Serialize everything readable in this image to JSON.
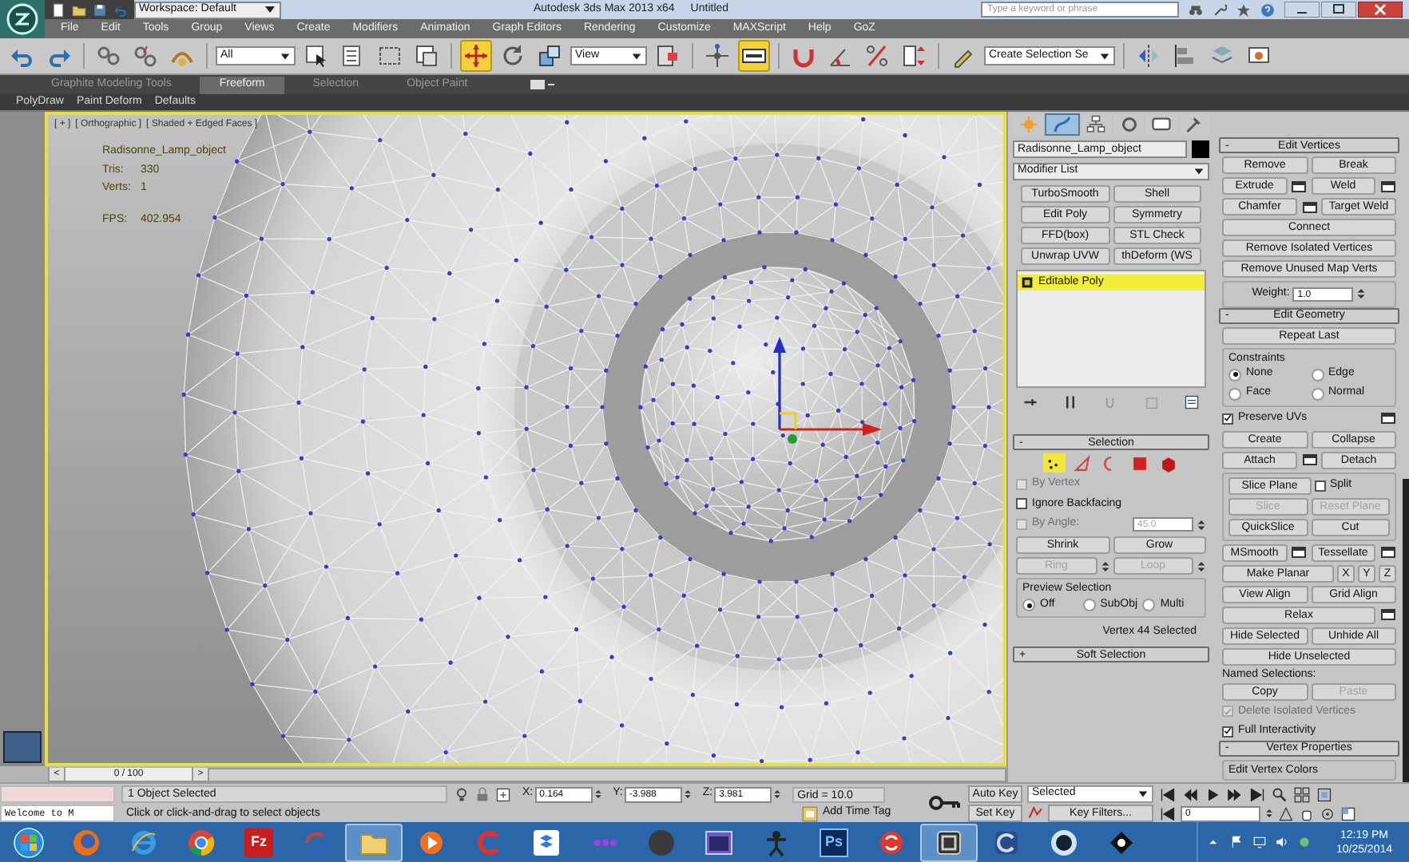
{
  "title_bar": {
    "workspace": "Workspace: Default",
    "app_title": "Autodesk 3ds Max  2013 x64",
    "document": "Untitled",
    "search_placeholder": "Type a keyword or phrase"
  },
  "menu": [
    "File",
    "Edit",
    "Tools",
    "Group",
    "Views",
    "Create",
    "Modifiers",
    "Animation",
    "Graph Editors",
    "Rendering",
    "Customize",
    "MAXScript",
    "Help",
    "GoZ"
  ],
  "toolbar": [
    {
      "kind": "undo",
      "selected": false
    },
    {
      "kind": "redo",
      "selected": false
    },
    {
      "kind": "separator"
    },
    {
      "kind": "link",
      "selected": false
    },
    {
      "kind": "unlink",
      "selected": false
    },
    {
      "kind": "bind",
      "selected": false
    },
    {
      "kind": "separator"
    },
    {
      "kind": "dropdown",
      "value": "All"
    },
    {
      "kind": "select",
      "selected": false
    },
    {
      "kind": "selectname",
      "selected": false
    },
    {
      "kind": "region",
      "selected": false
    },
    {
      "kind": "crossing",
      "selected": false
    },
    {
      "kind": "separator"
    },
    {
      "kind": "move",
      "selected": true
    },
    {
      "kind": "rotate",
      "selected": false
    },
    {
      "kind": "scale",
      "selected": false
    },
    {
      "kind": "dropdown",
      "value": "View"
    },
    {
      "kind": "pivot",
      "selected": false
    },
    {
      "kind": "separator"
    },
    {
      "kind": "manipulate",
      "selected": false
    },
    {
      "kind": "keyboard",
      "selected": true
    },
    {
      "kind": "separator"
    },
    {
      "kind": "snap",
      "selected": false
    },
    {
      "kind": "anglesnap",
      "selected": false
    },
    {
      "kind": "percentsnap",
      "selected": false
    },
    {
      "kind": "spinsnap",
      "selected": false
    },
    {
      "kind": "separator"
    },
    {
      "kind": "editnamed",
      "selected": false
    },
    {
      "kind": "dropdown",
      "value": "Create Selection Se"
    },
    {
      "kind": "separator"
    },
    {
      "kind": "mirror",
      "selected": false
    },
    {
      "kind": "align",
      "selected": false
    },
    {
      "kind": "layers",
      "selected": false
    },
    {
      "kind": "render",
      "selected": false
    }
  ],
  "ribbon": {
    "tabs": [
      {
        "label": "Graphite Modeling Tools",
        "selected": false
      },
      {
        "label": "Freeform",
        "selected": true
      },
      {
        "label": "Selection",
        "selected": false
      },
      {
        "label": "Object Paint",
        "selected": false
      }
    ],
    "panels": [
      "PolyDraw",
      "Paint Deform",
      "Defaults"
    ]
  },
  "viewport": {
    "active": true,
    "labels": [
      "[ + ]",
      "[ Orthographic ]",
      "[ Shaded + Edged Faces ]"
    ],
    "object": "Radisonne_Lamp_object",
    "stats": [
      {
        "label": "Tris:",
        "value": "330"
      },
      {
        "label": "Verts:",
        "value": "1"
      },
      {
        "label": "FPS:",
        "value": "402.954"
      }
    ]
  },
  "command_panel": {
    "tabs": [
      {
        "kind": "create",
        "selected": false
      },
      {
        "kind": "modify",
        "selected": true
      },
      {
        "kind": "hierarchy",
        "selected": false
      },
      {
        "kind": "motion",
        "selected": false
      },
      {
        "kind": "display",
        "selected": false
      },
      {
        "kind": "utilities",
        "selected": false
      }
    ],
    "object_name": "Radisonne_Lamp_object",
    "modifier_list": "Modifier List",
    "modifier_buttons": [
      "TurboSmooth",
      "Shell",
      "Edit Poly",
      "Symmetry",
      "FFD(box)",
      "STL Check",
      "Unwrap UVW",
      "thDeform (WS"
    ],
    "stack": [
      {
        "label": "Editable Poly",
        "selected": true
      }
    ],
    "stack_tools": [
      {
        "kind": "pin",
        "disabled": false
      },
      {
        "kind": "showend",
        "disabled": false
      },
      {
        "kind": "unique",
        "disabled": true
      },
      {
        "kind": "remove",
        "disabled": true
      },
      {
        "kind": "configure",
        "disabled": false
      }
    ],
    "rollouts": [
      {
        "sign": "-",
        "title": "Selection",
        "items": [
          {
            "kind": "levels",
            "items": [
              {
                "kind": "vertex",
                "selected": true
              },
              {
                "kind": "edge",
                "selected": false
              },
              {
                "kind": "border",
                "selected": false
              },
              {
                "kind": "polygon",
                "selected": false
              },
              {
                "kind": "element",
                "selected": false
              }
            ]
          },
          {
            "kind": "checkbox",
            "label": "By Vertex",
            "checked": false,
            "disabled": true
          },
          {
            "kind": "checkbox",
            "label": "Ignore Backfacing",
            "checked": false,
            "disabled": false
          },
          {
            "kind": "row",
            "items": [
              {
                "kind": "checkbox",
                "label": "By Angle:",
                "checked": false,
                "disabled": true
              },
              {
                "kind": "spinner",
                "value": "45.0",
                "disabled": true
              }
            ]
          },
          {
            "kind": "row",
            "items": [
              {
                "kind": "button",
                "label": "Shrink",
                "disabled": false
              },
              {
                "kind": "button",
                "label": "Grow",
                "disabled": false
              }
            ]
          },
          {
            "kind": "row",
            "items": [
              {
                "kind": "button",
                "label": "Ring",
                "disabled": true
              },
              {
                "kind": "spin"
              },
              {
                "kind": "button",
                "label": "Loop",
                "disabled": true
              },
              {
                "kind": "spin"
              }
            ]
          },
          {
            "kind": "group",
            "title": "Preview Selection",
            "items": [
              {
                "kind": "row",
                "items": [
                  {
                    "kind": "radio",
                    "label": "Off",
                    "selected": true
                  },
                  {
                    "kind": "radio",
                    "label": "SubObj",
                    "selected": false
                  },
                  {
                    "kind": "radio",
                    "label": "Multi",
                    "selected": false
                  }
                ]
              }
            ]
          },
          {
            "kind": "status",
            "label": "Vertex 44 Selected"
          }
        ]
      },
      {
        "sign": "+",
        "title": "Soft Selection"
      }
    ]
  },
  "modify_panel": {
    "rollouts": [
      {
        "sign": "-",
        "title": "Edit Vertices",
        "items": [
          {
            "kind": "row",
            "items": [
              {
                "kind": "button",
                "label": "Remove",
                "disabled": false
              },
              {
                "kind": "button",
                "label": "Break",
                "disabled": false
              }
            ]
          },
          {
            "kind": "row",
            "items": [
              {
                "kind": "button",
                "label": "Extrude",
                "disabled": false
              },
              {
                "kind": "settings"
              },
              {
                "kind": "button",
                "label": "Weld",
                "disabled": false
              },
              {
                "kind": "settings"
              }
            ]
          },
          {
            "kind": "row",
            "items": [
              {
                "kind": "button",
                "label": "Chamfer",
                "disabled": false
              },
              {
                "kind": "settings"
              },
              {
                "kind": "button",
                "label": "Target Weld",
                "disabled": false
              }
            ]
          },
          {
            "kind": "row",
            "items": [
              {
                "kind": "button",
                "label": "Connect",
                "disabled": false
              }
            ]
          },
          {
            "kind": "row",
            "items": [
              {
                "kind": "button",
                "label": "Remove Isolated Vertices",
                "disabled": false
              }
            ]
          },
          {
            "kind": "row",
            "items": [
              {
                "kind": "button",
                "label": "Remove Unused Map Verts",
                "disabled": false
              }
            ]
          },
          {
            "kind": "group",
            "items": [
              {
                "kind": "spinner",
                "label": "Weight:",
                "value": "1.0",
                "disabled": false
              }
            ]
          }
        ]
      },
      {
        "sign": "-",
        "title": "Edit Geometry",
        "items": [
          {
            "kind": "row",
            "items": [
              {
                "kind": "button",
                "label": "Repeat Last",
                "disabled": false
              }
            ]
          },
          {
            "kind": "group",
            "title": "Constraints",
            "items": [
              {
                "kind": "row",
                "items": [
                  {
                    "kind": "radio",
                    "label": "None",
                    "selected": true
                  },
                  {
                    "kind": "radio",
                    "label": "Edge",
                    "selected": false
                  }
                ]
              },
              {
                "kind": "row",
                "items": [
                  {
                    "kind": "radio",
                    "label": "Face",
                    "selected": false
                  },
                  {
                    "kind": "radio",
                    "label": "Normal",
                    "selected": false
                  }
                ]
              }
            ]
          },
          {
            "kind": "row",
            "items": [
              {
                "kind": "checkbox",
                "label": "Preserve UVs",
                "checked": true,
                "disabled": false
              },
              {
                "kind": "settings"
              }
            ]
          },
          {
            "kind": "row",
            "items": [
              {
                "kind": "button",
                "label": "Create",
                "disabled": false
              },
              {
                "kind": "button",
                "label": "Collapse",
                "disabled": false
              }
            ]
          },
          {
            "kind": "row",
            "items": [
              {
                "kind": "button",
                "label": "Attach",
                "disabled": false
              },
              {
                "kind": "settings"
              },
              {
                "kind": "button",
                "label": "Detach",
                "disabled": false
              }
            ]
          },
          {
            "kind": "group",
            "items": [
              {
                "kind": "row",
                "items": [
                  {
                    "kind": "button",
                    "label": "Slice Plane",
                    "disabled": false
                  },
                  {
                    "kind": "checkbox",
                    "label": "Split",
                    "checked": false,
                    "disabled": false
                  }
                ]
              },
              {
                "kind": "row",
                "items": [
                  {
                    "kind": "button",
                    "label": "Slice",
                    "disabled": true
                  },
                  {
                    "kind": "button",
                    "label": "Reset Plane",
                    "disabled": true
                  }
                ]
              },
              {
                "kind": "row",
                "items": [
                  {
                    "kind": "button",
                    "label": "QuickSlice",
                    "disabled": false
                  },
                  {
                    "kind": "button",
                    "label": "Cut",
                    "disabled": false
                  }
                ]
              }
            ]
          },
          {
            "kind": "row",
            "items": [
              {
                "kind": "button",
                "label": "MSmooth",
                "disabled": false
              },
              {
                "kind": "settings"
              },
              {
                "kind": "button",
                "label": "Tessellate",
                "disabled": false
              },
              {
                "kind": "settings"
              }
            ]
          },
          {
            "kind": "row",
            "items": [
              {
                "kind": "button",
                "label": "Make Planar",
                "disabled": false
              },
              {
                "kind": "axis",
                "label": "X"
              },
              {
                "kind": "axis",
                "label": "Y"
              },
              {
                "kind": "axis",
                "label": "Z"
              }
            ]
          },
          {
            "kind": "row",
            "items": [
              {
                "kind": "button",
                "label": "View Align",
                "disabled": false
              },
              {
                "kind": "button",
                "label": "Grid Align",
                "disabled": false
              }
            ]
          },
          {
            "kind": "row",
            "items": [
              {
                "kind": "button",
                "label": "Relax",
                "disabled": false
              },
              {
                "kind": "settings"
              }
            ]
          },
          {
            "kind": "row",
            "items": [
              {
                "kind": "button",
                "label": "Hide Selected",
                "disabled": false
              },
              {
                "kind": "button",
                "label": "Unhide All",
                "disabled": false
              }
            ]
          },
          {
            "kind": "row",
            "items": [
              {
                "kind": "button",
                "label": "Hide Unselected",
                "disabled": false
              }
            ]
          },
          {
            "kind": "text",
            "label": "Named Selections:"
          },
          {
            "kind": "row",
            "items": [
              {
                "kind": "button",
                "label": "Copy",
                "disabled": false
              },
              {
                "kind": "button",
                "label": "Paste",
                "disabled": true
              }
            ]
          },
          {
            "kind": "checkbox",
            "label": "Delete Isolated Vertices",
            "checked": true,
            "disabled": true
          },
          {
            "kind": "checkbox",
            "label": "Full Interactivity",
            "checked": true,
            "disabled": false
          }
        ]
      },
      {
        "sign": "-",
        "title": "Vertex Properties",
        "items": [
          {
            "kind": "group",
            "title": "Edit Vertex Colors"
          }
        ]
      }
    ]
  },
  "timeline": {
    "prev": "<",
    "position": "0 / 100",
    "level": 0,
    "next": ">"
  },
  "status_bar": {
    "listener": "Welcome to M",
    "selection": "1 Object Selected",
    "prompt": "Click or click-and-drag to select objects",
    "coords": [
      {
        "label": "X:",
        "value": "0.164"
      },
      {
        "label": "Y:",
        "value": "-3.988"
      },
      {
        "label": "Z:",
        "value": "3.981"
      }
    ],
    "grid": "Grid = 10.0",
    "time_tag": "Add Time Tag"
  },
  "animation": {
    "auto_key": "Auto Key",
    "set_key": "Set Key",
    "key_mode": "Selected",
    "key_filters": "Key Filters...",
    "frame": "0"
  },
  "taskbar": {
    "apps": [
      {
        "kind": "firefox",
        "selected": false
      },
      {
        "kind": "ie",
        "selected": false
      },
      {
        "kind": "chrome",
        "selected": false
      },
      {
        "kind": "filezilla",
        "label": "Fz",
        "selected": false
      },
      {
        "kind": "sync",
        "selected": false
      },
      {
        "kind": "folder",
        "selected": true
      },
      {
        "kind": "media",
        "selected": false
      },
      {
        "kind": "ccleaner",
        "selected": false
      },
      {
        "kind": "dropbox",
        "selected": false
      },
      {
        "kind": "dots",
        "selected": false
      },
      {
        "kind": "avatar",
        "selected": false
      },
      {
        "kind": "window",
        "selected": false
      },
      {
        "kind": "figure",
        "selected": false
      },
      {
        "kind": "photoshop",
        "label": "Ps",
        "selected": false
      },
      {
        "kind": "swirl",
        "selected": false
      },
      {
        "kind": "max",
        "selected": true
      },
      {
        "kind": "cube",
        "selected": false
      },
      {
        "kind": "aperture",
        "selected": false
      },
      {
        "kind": "diamond",
        "selected": false
      }
    ],
    "clock": {
      "time": "12:19 PM",
      "date": "10/25/2014"
    }
  }
}
